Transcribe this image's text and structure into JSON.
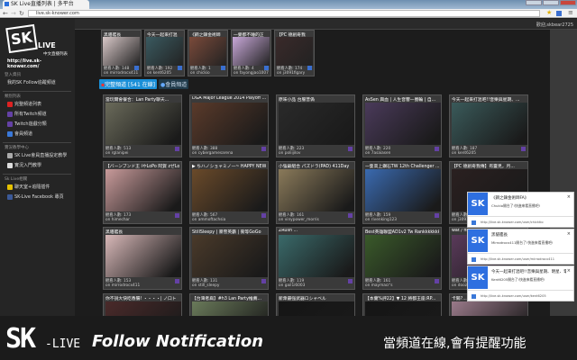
{
  "browser": {
    "tab_title": "SK Live直播列表 | 多平台",
    "url": "live.sk-knower.com"
  },
  "sidebar": {
    "logo_sk": "SK",
    "logo_live": "LIVE",
    "logo_sub": "中文直播列表",
    "logo_url": "http://live.sk-knower.com/",
    "sections": [
      {
        "title": "登入資訊",
        "items": [
          {
            "label": "我的SK Follow追蹤頻道",
            "icon": "none"
          }
        ]
      },
      {
        "title": "類別列表",
        "items": [
          {
            "label": "完整頻道列表",
            "icon": "taiwan-flag-icon",
            "color": "#d22"
          },
          {
            "label": "所有Twitch頻道",
            "icon": "twitch-icon",
            "color": "#6441a5"
          },
          {
            "label": "Twitch遊戲分類",
            "icon": "twitch-icon",
            "color": "#6441a5"
          },
          {
            "label": "會員頻道",
            "icon": "member-icon",
            "color": "#3a78d8"
          }
        ]
      },
      {
        "title": "實況教學中心",
        "items": [
          {
            "label": "SK Live會員直播設定教學",
            "icon": "tutorial-icon",
            "color": "#aaa"
          },
          {
            "label": "實況入門教學",
            "icon": "info-icon",
            "color": "#ddd"
          }
        ]
      },
      {
        "title": "Sk Live相關",
        "items": [
          {
            "label": "聊天室+追隨插件",
            "icon": "chrome-firefox-icon",
            "color": "#e5c100"
          },
          {
            "label": "SK-Live Facebook 專頁",
            "icon": "facebook-icon",
            "color": "#3b5998"
          }
        ]
      }
    ]
  },
  "header": {
    "welcome": "歡迎,skbear2725"
  },
  "followed": [
    {
      "title": "黑貓艦長",
      "viewers": "觀看人數: 148",
      "channel": "on mirrodrocx411",
      "color": "#d8c8c8"
    },
    {
      "title": "今天一起來打混",
      "viewers": "觀看人數: 192",
      "channel": "on kent6205",
      "color": "#3a5a60"
    },
    {
      "title": "《鋼之鍊金術師",
      "viewers": "觀看人數: 1",
      "channel": "on chickio",
      "color": "#7a4a3a"
    },
    {
      "title": "一覺都不睡的正",
      "viewers": "觀看人數: 4",
      "channel": "on fayongjao1007",
      "color": "#c8a8d8"
    },
    {
      "title": "【PC 德創奇我",
      "viewers": "觀看人數: 174",
      "channel": "on j3091figary",
      "color": "#3a2a2a"
    }
  ],
  "tabs": {
    "full": "完整頻道 [541 在線]",
    "member": "會員頻道"
  },
  "channels": [
    {
      "title": "當玩爾會餐合：Lan Party聊天...",
      "viewers": "觀看人數: 513",
      "channel": "on rglanipei",
      "color": "#6a6a5a"
    },
    {
      "title": "DGA Major League 2014 Playoff ...",
      "viewers": "觀看人數: 388",
      "channel": "on cybergamesarena",
      "color": "#5a3a2a"
    },
    {
      "title": "原味小品 台服普偽",
      "viewers": "觀看人數: 223",
      "channel": "on poliijilov",
      "color": "#2a2a2a"
    },
    {
      "title": "AsSen 興血 | 人生音響一圈輪 | 自...",
      "viewers": "觀看人數: 220",
      "channel": "on 7asaiasen",
      "color": "#4a3a5a"
    },
    {
      "title": "今天一起來打混吧!!音樂與星期、...",
      "viewers": "觀看人數: 187",
      "channel": "on kent6205",
      "color": "#3a5a5a"
    },
    {
      "title": "【バーンブンド王 iやLoPo 阿賀 zぜLoD天...",
      "viewers": "觀看人數: 173",
      "channel": "on himechar",
      "color": "#c89a9a"
    },
    {
      "title": "▶ ちハノショャミノ—~ HAPPY NEW...",
      "viewers": "觀看人數: 567",
      "channel": "on ammoftachsia",
      "color": "#6a4a2a"
    },
    {
      "title": "小強爺組合 パズドラ(PAD) 411Day",
      "viewers": "觀看人數: 161",
      "channel": "on vinypower_morris",
      "color": "#8a7a5a"
    },
    {
      "title": "一隻高上鑽石TW 12th Challenger ...",
      "viewers": "觀看人數: 159",
      "channel": "on rivenking123",
      "color": "#3a6ab0"
    },
    {
      "title": "【PC 德創奇我傳】有靈見，月...",
      "viewers": "觀看人數: 174",
      "channel": "on j3091figary",
      "color": "#2a2020"
    },
    {
      "title": "黑貓艦長",
      "viewers": "觀看人數: 153",
      "channel": "on mirrodrocx411",
      "color": "#d8b8b8"
    },
    {
      "title": "StillSleepy | 暴雪英霸 | 衝等GoGo",
      "viewers": "觀看人數: 131",
      "channel": "on still_sleepy",
      "color": "#4a3a2a"
    },
    {
      "title": "ZRush ...",
      "viewers": "觀看人數: 119",
      "channel": "on gail1i6003",
      "color": "#3a6a6a"
    },
    {
      "title": "Best英雄聯盟AD1v2 Tw Rankkkkkkk",
      "viewers": "觀看人數: 161",
      "channel": "on maymacr's",
      "color": "#3a5a2a"
    },
    {
      "title": "wat / fine ...",
      "viewers": "觀看人數: 120",
      "channel": "on doozn",
      "color": "#5a3a5a"
    },
    {
      "title": "你不說大快吃香腸! ・・・・| ノ口ト",
      "viewers": "",
      "channel": "",
      "color": "#4a2a2a"
    },
    {
      "title": "【台灣者扁】#h3 Lan Party推薦...",
      "viewers": "",
      "channel": "",
      "color": "#6a7a5a"
    },
    {
      "title": "新衆最强武器ロシャベル",
      "viewers": "",
      "channel": "",
      "color": "#151515"
    },
    {
      "title": "【本蘭%評22】▼ 12 將都王座:RP...",
      "viewers": "",
      "channel": "",
      "color": "#151515"
    },
    {
      "title": "卡關?...",
      "viewers": "",
      "channel": "",
      "color": "#9a7a8a"
    }
  ],
  "notifications": [
    {
      "title": "《鋼之鍊金術師FA》",
      "body": "Chukio開台了!快進來看直播吧!",
      "url": "http://live.sk-knower.com/user/chicktio"
    },
    {
      "title": "黑貓艦長",
      "body": "Mirrodrocx411開台了!快進來看直播吧!",
      "url": "http://live.sk-knower.com/user/mirrodrocx411"
    },
    {
      "title": "今天一起來打混吧!!音樂與星期、明星、電影",
      "body": "Kent6205開台了!快進來看直播吧!",
      "url": "http://live.sk-knower.com/user/kent6205"
    }
  ],
  "banner": {
    "sk": "SK",
    "live": "-LIVE",
    "follow": "Follow Notification",
    "tagline": "當頻道在線,會有提醒功能"
  }
}
